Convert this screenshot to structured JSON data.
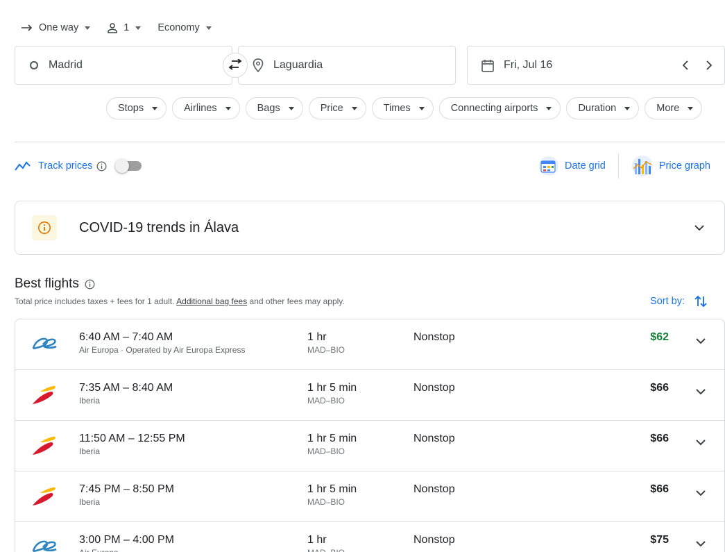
{
  "options": {
    "trip_type": "One way",
    "passengers": "1",
    "cabin": "Economy"
  },
  "search": {
    "origin": "Madrid",
    "destination": "Laguardia",
    "date": "Fri, Jul 16"
  },
  "filters": [
    "Stops",
    "Airlines",
    "Bags",
    "Price",
    "Times",
    "Connecting airports",
    "Duration",
    "More"
  ],
  "track": {
    "label": "Track prices",
    "enabled": false
  },
  "views": {
    "date_grid": "Date grid",
    "price_graph": "Price graph"
  },
  "covid": {
    "title": "COVID-19 trends in Álava"
  },
  "best": {
    "title": "Best flights",
    "subtitle_pre": "Total price includes taxes + fees for 1 adult. ",
    "subtitle_link": "Additional bag fees",
    "subtitle_post": " and other fees may apply.",
    "sort_label": "Sort by:"
  },
  "flights": [
    {
      "times": "6:40 AM – 7:40 AM",
      "airline": "Air Europa · Operated by Air Europa Express",
      "duration": "1 hr",
      "route": "MAD–BIO",
      "stops": "Nonstop",
      "price": "$62",
      "logo": "air-europa-logo",
      "cheapest": true
    },
    {
      "times": "7:35 AM – 8:40 AM",
      "airline": "Iberia",
      "duration": "1 hr 5 min",
      "route": "MAD–BIO",
      "stops": "Nonstop",
      "price": "$66",
      "logo": "iberia-logo",
      "cheapest": false
    },
    {
      "times": "11:50 AM – 12:55 PM",
      "airline": "Iberia",
      "duration": "1 hr 5 min",
      "route": "MAD–BIO",
      "stops": "Nonstop",
      "price": "$66",
      "logo": "iberia-logo",
      "cheapest": false
    },
    {
      "times": "7:45 PM – 8:50 PM",
      "airline": "Iberia",
      "duration": "1 hr 5 min",
      "route": "MAD–BIO",
      "stops": "Nonstop",
      "price": "$66",
      "logo": "iberia-logo",
      "cheapest": false
    },
    {
      "times": "3:00 PM – 4:00 PM",
      "airline": "Air Europa",
      "duration": "1 hr",
      "route": "MAD–BIO",
      "stops": "Nonstop",
      "price": "$75",
      "logo": "air-europa-logo",
      "cheapest": false
    }
  ],
  "colors": {
    "accent": "#1a73e8",
    "cheap_price": "#188038",
    "border": "#dadce0"
  }
}
